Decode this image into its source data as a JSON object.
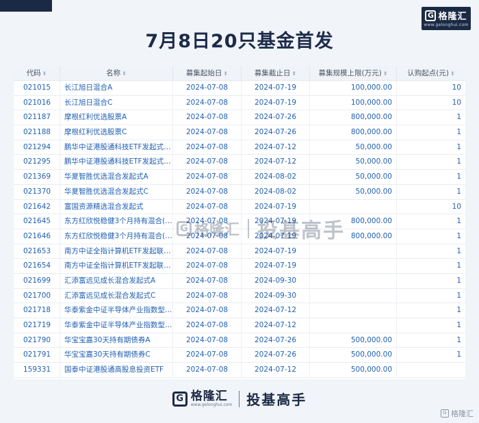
{
  "header": {
    "title": "7月8日20只基金首发",
    "brand_name": "格隆汇",
    "brand_url": "www.gelonghui.com",
    "brand_letter": "G"
  },
  "table": {
    "columns": [
      "代码",
      "名称",
      "募集起始日",
      "募集截止日",
      "募集规模上限(万元)",
      "认购起点(元)"
    ],
    "sort_icon": "⬍",
    "rows": [
      [
        "021015",
        "长江旭日混合A",
        "2024-07-08",
        "2024-07-19",
        "100,000.00",
        "10"
      ],
      [
        "021016",
        "长江旭日混合C",
        "2024-07-08",
        "2024-07-19",
        "100,000.00",
        "10"
      ],
      [
        "021187",
        "摩根红利优选股票A",
        "2024-07-08",
        "2024-07-26",
        "800,000.00",
        "1"
      ],
      [
        "021188",
        "摩根红利优选股票C",
        "2024-07-08",
        "2024-07-26",
        "800,000.00",
        "1"
      ],
      [
        "021294",
        "鹏华中证港股通科技ETF发起式…",
        "2024-07-08",
        "2024-07-12",
        "50,000.00",
        "1"
      ],
      [
        "021295",
        "鹏华中证港股通科技ETF发起式…",
        "2024-07-08",
        "2024-07-12",
        "50,000.00",
        "1"
      ],
      [
        "021369",
        "华夏智胜优选混合发起式A",
        "2024-07-08",
        "2024-08-02",
        "50,000.00",
        "1"
      ],
      [
        "021370",
        "华夏智胜优选混合发起式C",
        "2024-07-08",
        "2024-08-02",
        "50,000.00",
        "1"
      ],
      [
        "021642",
        "富国资源精选混合发起式",
        "2024-07-08",
        "2024-07-19",
        "",
        "10"
      ],
      [
        "021645",
        "东方红欣悦稳健3个月持有混合(…",
        "2024-07-08",
        "2024-07-19",
        "800,000.00",
        "1"
      ],
      [
        "021646",
        "东方红欣悦稳健3个月持有混合(…",
        "2024-07-08",
        "2024-07-19",
        "800,000.00",
        "1"
      ],
      [
        "021653",
        "南方中证全指计算机ETF发起联…",
        "2024-07-08",
        "2024-07-19",
        "",
        "1"
      ],
      [
        "021654",
        "南方中证全指计算机ETF发起联…",
        "2024-07-08",
        "2024-07-19",
        "",
        "1"
      ],
      [
        "021699",
        "汇添富远见成长混合发起式A",
        "2024-07-08",
        "2024-09-30",
        "",
        "1"
      ],
      [
        "021700",
        "汇添富远见成长混合发起式C",
        "2024-07-08",
        "2024-09-30",
        "",
        "1"
      ],
      [
        "021718",
        "华泰紫金中证半导体产业指数型…",
        "2024-07-08",
        "2024-07-12",
        "",
        "1"
      ],
      [
        "021719",
        "华泰紫金中证半导体产业指数型…",
        "2024-07-08",
        "2024-07-12",
        "",
        "1"
      ],
      [
        "021790",
        "华宝宝嘉30天持有期债券A",
        "2024-07-08",
        "2024-07-26",
        "500,000.00",
        "1"
      ],
      [
        "021791",
        "华宝宝嘉30天持有期债券C",
        "2024-07-08",
        "2024-07-26",
        "500,000.00",
        "1"
      ],
      [
        "159331",
        "国泰中证港股通高股息投资ETF",
        "2024-07-08",
        "2024-07-12",
        "500,000.00",
        ""
      ]
    ]
  },
  "watermark": {
    "brand_letter": "G",
    "brand_name": "格隆汇",
    "slogan": "投基高手"
  },
  "footer": {
    "brand_letter": "G",
    "brand_name": "格隆汇",
    "brand_url": "www.gelonghui.com",
    "slogan": "投基高手"
  },
  "corner_mark": {
    "brand_letter": "G",
    "text": "格隆汇"
  },
  "colors": {
    "title": "#1d2b4a",
    "link_text": "#1f5fb3",
    "brand_dark": "#1b2a44",
    "background": "#f1f4f8"
  }
}
